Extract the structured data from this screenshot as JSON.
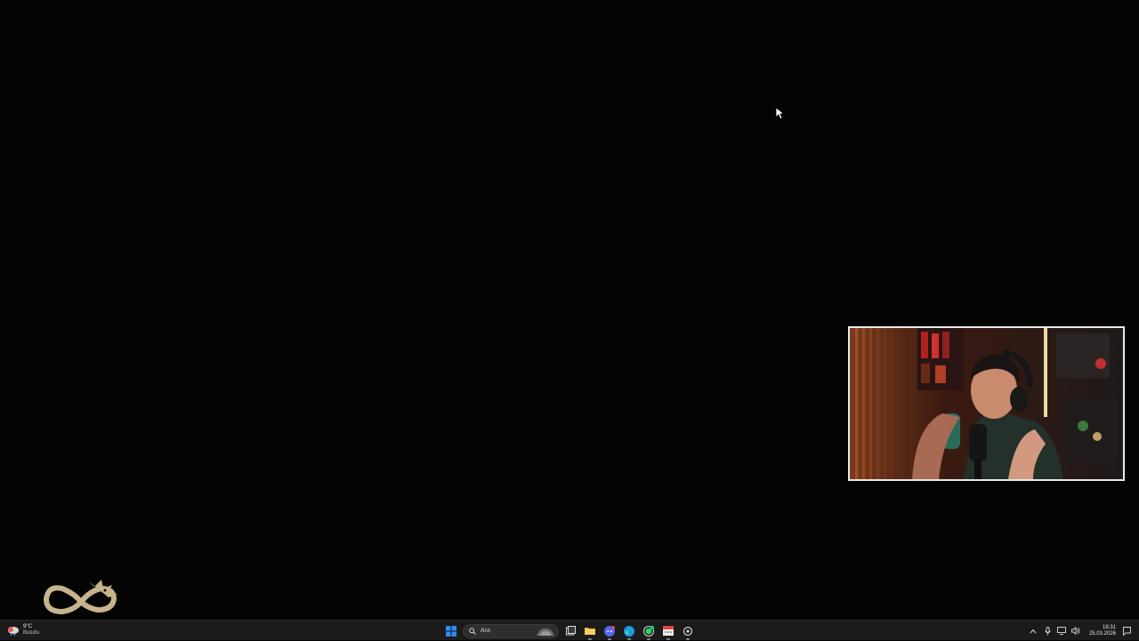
{
  "taskbar": {
    "weather": {
      "temperature": "9°C",
      "condition": "Bulutlu",
      "icon": "cloud-rain-icon"
    },
    "search": {
      "placeholder": "Ara"
    },
    "pinned_apps": [
      "start-icon",
      "task-view-icon",
      "file-explorer-icon",
      "discord-icon",
      "edge-icon",
      "whatsapp-icon",
      "calendar-app-icon",
      "settings-icon"
    ],
    "tray": {
      "time": "18:31",
      "date": "25.03.2026",
      "icons": [
        "chevron-up-icon",
        "microphone-icon",
        "network-icon",
        "volume-icon",
        "notification-icon"
      ]
    }
  },
  "colors": {
    "desktop_bg": "#040404",
    "taskbar_bg": "#1b1b1b",
    "start_blue": "#2f8cf0",
    "logo_gold": "#c8b48c",
    "webcam_border": "#e9e9e9"
  }
}
